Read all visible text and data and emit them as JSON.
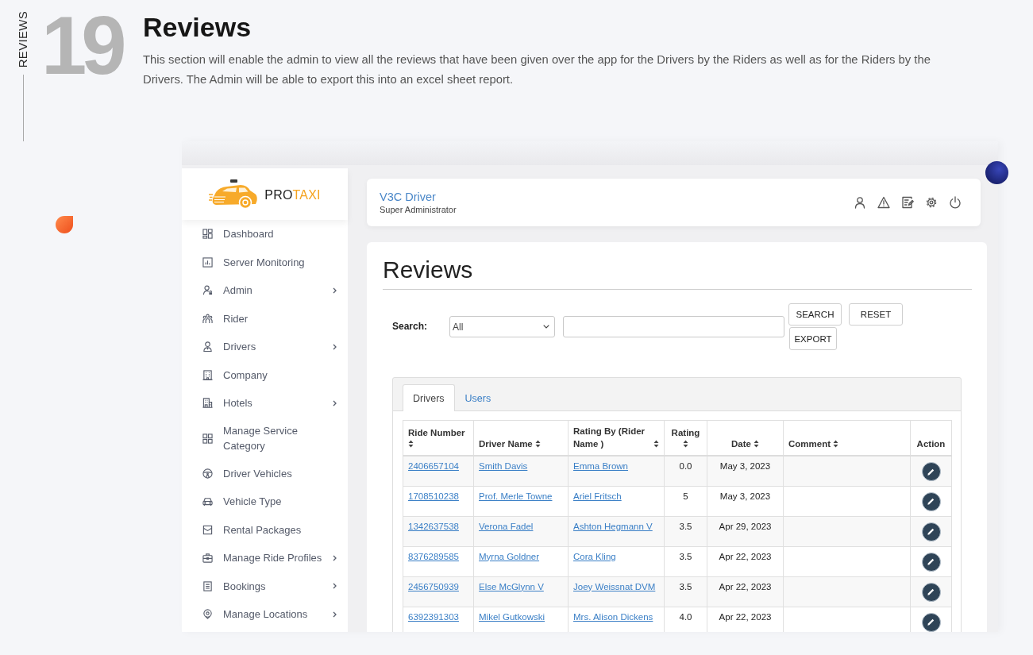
{
  "section": {
    "label": "REVIEWS",
    "number": "19",
    "title": "Reviews",
    "description": "This section will enable the admin to view all the reviews that have been given over the app for the Drivers by the Riders as well as for the Riders by the Drivers. The Admin will be able to export this into an excel sheet report."
  },
  "app": {
    "logo": {
      "brand": [
        "PRO",
        "TAXI"
      ]
    },
    "sidebar": {
      "items": [
        {
          "label": "Dashboard",
          "submenu": false
        },
        {
          "label": "Server Monitoring",
          "submenu": false
        },
        {
          "label": "Admin",
          "submenu": true
        },
        {
          "label": "Rider",
          "submenu": false
        },
        {
          "label": "Drivers",
          "submenu": true
        },
        {
          "label": "Company",
          "submenu": false
        },
        {
          "label": "Hotels",
          "submenu": true
        },
        {
          "label": "Manage Service Category",
          "submenu": false
        },
        {
          "label": "Driver Vehicles",
          "submenu": false
        },
        {
          "label": "Vehicle Type",
          "submenu": false
        },
        {
          "label": "Rental Packages",
          "submenu": false
        },
        {
          "label": "Manage Ride Profiles",
          "submenu": true
        },
        {
          "label": "Bookings",
          "submenu": true
        },
        {
          "label": "Manage Locations",
          "submenu": true
        }
      ]
    },
    "header": {
      "user_name": "V3C Driver",
      "user_role": "Super Administrator"
    },
    "content": {
      "title": "Reviews",
      "search": {
        "label": "Search:",
        "filter": "All"
      },
      "buttons": [
        "SEARCH",
        "RESET",
        "EXPORT"
      ],
      "tabs": [
        {
          "label": "Drivers",
          "selected": true
        },
        {
          "label": "Users",
          "selected": false
        }
      ],
      "table": {
        "columns": [
          {
            "label": "Ride Number",
            "sortable": true
          },
          {
            "label": "Driver Name",
            "sortable": true
          },
          {
            "label": "Rating By (Rider Name )",
            "sortable": true
          },
          {
            "label": "Rating",
            "sortable": true
          },
          {
            "label": "Date",
            "sortable": true
          },
          {
            "label": "Comment",
            "sortable": true
          },
          {
            "label": "Action",
            "sortable": false
          }
        ],
        "rows": [
          {
            "ride_number": "2406657104",
            "driver_name": "Smith Davis",
            "rating_by": "Emma Brown",
            "rating": "0.0",
            "date": "May 3, 2023"
          },
          {
            "ride_number": "1708510238",
            "driver_name": "Prof. Merle Towne",
            "rating_by": "Ariel Fritsch",
            "rating": "5",
            "date": "May 3, 2023"
          },
          {
            "ride_number": "1342637538",
            "driver_name": "Verona Fadel",
            "rating_by": "Ashton Hegmann V",
            "rating": "3.5",
            "date": "Apr 29, 2023"
          },
          {
            "ride_number": "8376289585",
            "driver_name": "Myrna Goldner",
            "rating_by": "Cora Kling",
            "rating": "3.5",
            "date": "Apr 22, 2023"
          },
          {
            "ride_number": "2456750939",
            "driver_name": "Else McGlynn V",
            "rating_by": "Joey Weissnat DVM",
            "rating": "3.5",
            "date": "Apr 22, 2023"
          },
          {
            "ride_number": "6392391303",
            "driver_name": "Mikel Gutkowski",
            "rating_by": "Mrs. Alison Dickens",
            "rating": "4.0",
            "date": "Apr 22, 2023"
          }
        ]
      }
    }
  }
}
